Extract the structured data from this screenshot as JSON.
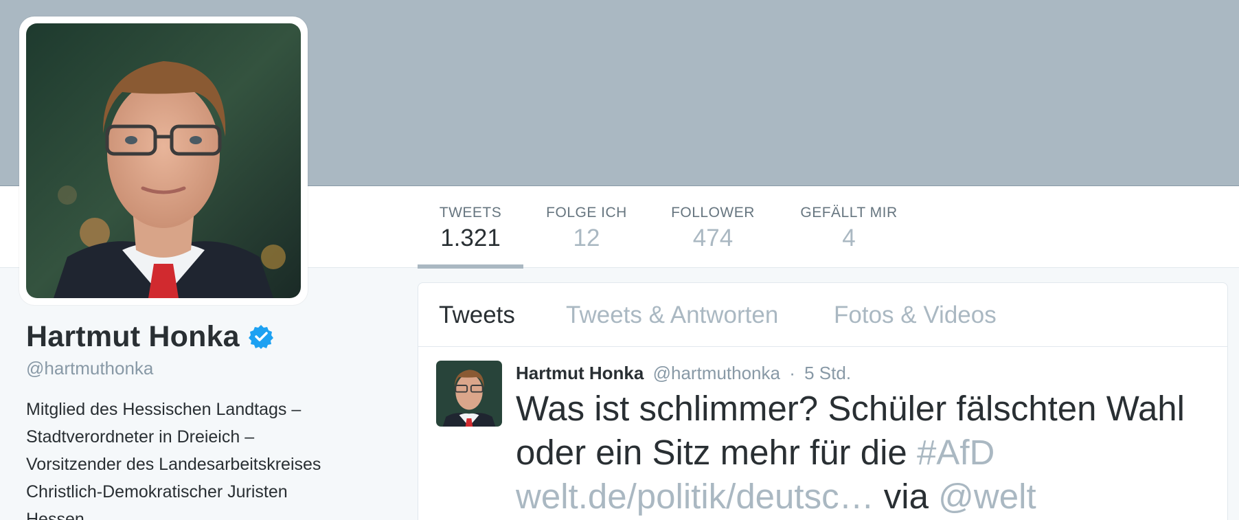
{
  "profile": {
    "name": "Hartmut Honka",
    "handle": "@hartmuthonka",
    "bio_lines": [
      "Mitglied des Hessischen Landtags –",
      "Stadtverordneter in Dreieich –",
      "Vorsitzender des Landesarbeitskreises",
      "Christlich-Demokratischer Juristen",
      "Hessen"
    ],
    "verified_icon": "verified-badge-icon"
  },
  "nav": {
    "items": [
      {
        "label": "TWEETS",
        "value": "1.321"
      },
      {
        "label": "FOLGE ICH",
        "value": "12"
      },
      {
        "label": "FOLLOWER",
        "value": "474"
      },
      {
        "label": "GEFÄLLT MIR",
        "value": "4"
      }
    ],
    "active_index": 0
  },
  "tabs": [
    {
      "label": "Tweets"
    },
    {
      "label": "Tweets & Antworten"
    },
    {
      "label": "Fotos & Videos"
    }
  ],
  "tweet": {
    "author": "Hartmut Honka",
    "handle": "@hartmuthonka",
    "separator": "·",
    "time": "5 Std.",
    "text_part1": "Was ist schlimmer? Schüler fälschten Wahl oder ein Sitz mehr für die ",
    "hashtag": "#AfD",
    "link": "welt.de/politik/deutsc…",
    "via": " via ",
    "mention": "@welt"
  },
  "colors": {
    "banner": "#aab8c2",
    "verified": "#1da1f2",
    "link": "#aab8c2",
    "text": "#292f33"
  }
}
